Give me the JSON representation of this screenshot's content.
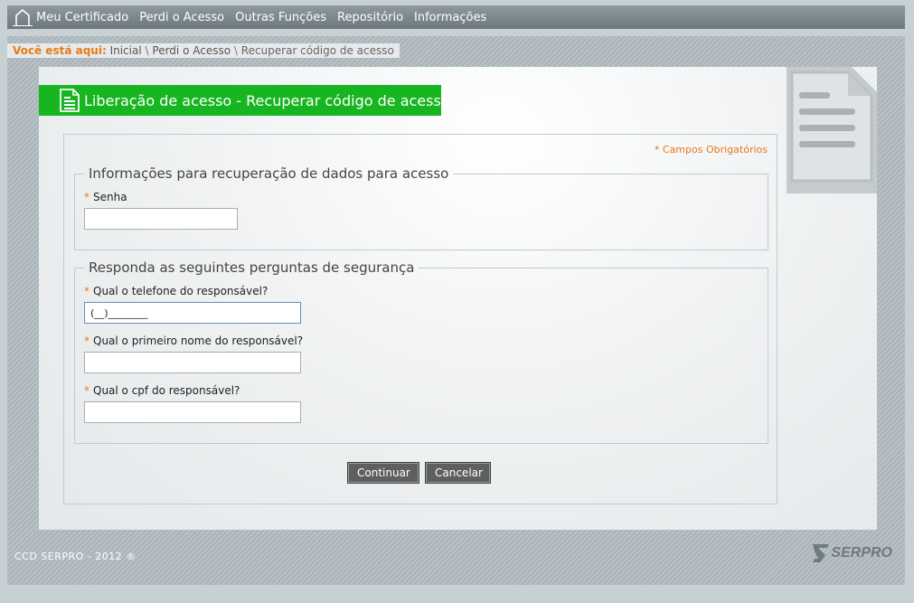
{
  "nav": {
    "items": [
      {
        "label": "Meu Certificado"
      },
      {
        "label": "Perdi o Acesso"
      },
      {
        "label": "Outras Funções"
      },
      {
        "label": "Repositório"
      },
      {
        "label": "Informações"
      }
    ]
  },
  "breadcrumb": {
    "label": "Você está aqui:",
    "items": [
      "Inicial",
      "Perdi o Acesso"
    ],
    "separator": "\\",
    "current": "Recuperar código de acesso"
  },
  "page": {
    "title": "Liberação de acesso - Recuperar código de acesso",
    "required_note": "* Campos Obrigatórios"
  },
  "recovery_section": {
    "legend": "Informações para recuperação de dados para acesso",
    "password": {
      "star": "*",
      "label": "Senha",
      "value": ""
    }
  },
  "security_section": {
    "legend": "Responda as seguintes perguntas de segurança",
    "phone": {
      "star": "*",
      "label": "Qual o telefone do responsável?",
      "value": "(__)________"
    },
    "first_name": {
      "star": "*",
      "label": "Qual o primeiro nome do responsável?",
      "value": ""
    },
    "cpf": {
      "star": "*",
      "label": "Qual o cpf do responsável?",
      "value": ""
    }
  },
  "actions": {
    "continue_label": "Continuar",
    "cancel_label": "Cancelar"
  },
  "footer": {
    "copyright": "CCD SERPRO - 2012 ®",
    "logo_text": "SERPRO"
  },
  "colors": {
    "accent_orange": "#e87a1a",
    "title_green": "#17b51f",
    "button_gray": "#5d5f60"
  }
}
